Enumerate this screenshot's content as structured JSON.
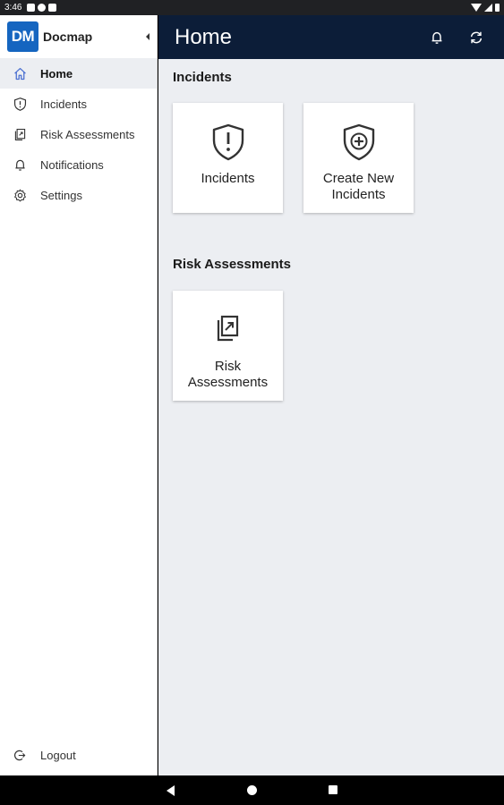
{
  "status_bar": {
    "time": "3:46"
  },
  "brand": {
    "logo_text": "DM",
    "name": "Docmap"
  },
  "sidebar": {
    "items": [
      {
        "label": "Home",
        "icon": "home-icon",
        "active": true
      },
      {
        "label": "Incidents",
        "icon": "shield-alert-icon",
        "active": false
      },
      {
        "label": "Risk Assessments",
        "icon": "document-icon",
        "active": false
      },
      {
        "label": "Notifications",
        "icon": "bell-icon",
        "active": false
      },
      {
        "label": "Settings",
        "icon": "gear-icon",
        "active": false
      }
    ],
    "logout_label": "Logout"
  },
  "header": {
    "title": "Home"
  },
  "sections": [
    {
      "title": "Incidents",
      "cards": [
        {
          "label": "Incidents",
          "icon": "shield-exclamation-icon"
        },
        {
          "label": "Create New Incidents",
          "icon": "shield-plus-icon"
        }
      ]
    },
    {
      "title": "Risk Assessments",
      "cards": [
        {
          "label": "Risk Assessments",
          "icon": "documents-arrow-icon"
        }
      ]
    }
  ],
  "colors": {
    "header_bg": "#0c1d38",
    "brand_blue": "#1565c0",
    "content_bg": "#eceef2"
  }
}
